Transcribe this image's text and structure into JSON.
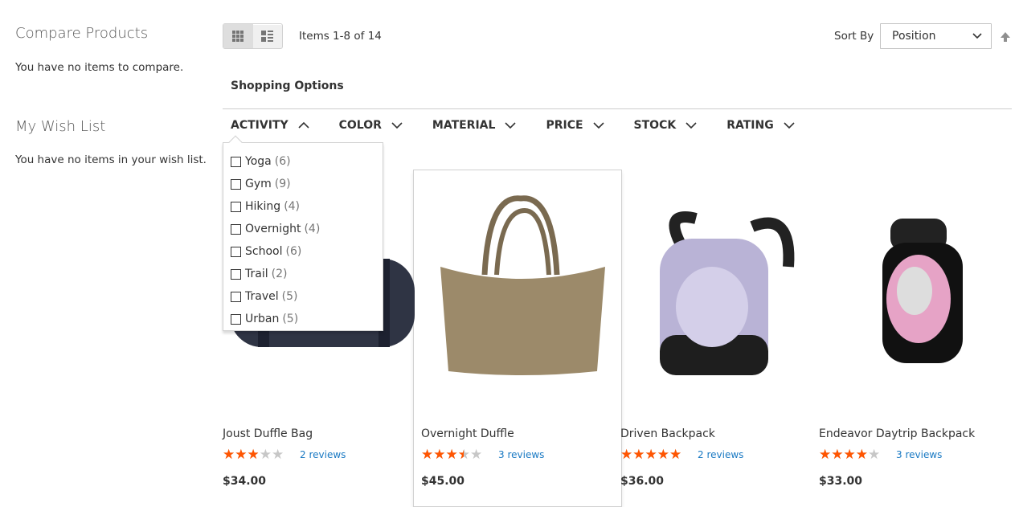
{
  "sidebar": {
    "compare_title": "Compare Products",
    "compare_text": "You have no items to compare.",
    "wishlist_title": "My Wish List",
    "wishlist_text": "You have no items in your wish list."
  },
  "toolbar": {
    "modes": [
      {
        "icon": "grid-icon",
        "active": true
      },
      {
        "icon": "list-icon",
        "active": false
      }
    ],
    "amount": "Items 1-8 of 14",
    "sort_label": "Sort By",
    "sort_value": "Position",
    "sort_direction_icon": "arrow-up-icon"
  },
  "filters": {
    "title": "Shopping Options",
    "items": [
      {
        "label": "ACTIVITY",
        "open": true
      },
      {
        "label": "COLOR"
      },
      {
        "label": "MATERIAL"
      },
      {
        "label": "PRICE"
      },
      {
        "label": "STOCK"
      },
      {
        "label": "RATING"
      }
    ],
    "activity_options": [
      {
        "label": "Yoga",
        "count": "(6)"
      },
      {
        "label": "Gym",
        "count": "(9)"
      },
      {
        "label": "Hiking",
        "count": "(4)"
      },
      {
        "label": "Overnight",
        "count": "(4)"
      },
      {
        "label": "School",
        "count": "(6)"
      },
      {
        "label": "Trail",
        "count": "(2)"
      },
      {
        "label": "Travel",
        "count": "(5)"
      },
      {
        "label": "Urban",
        "count": "(5)"
      }
    ]
  },
  "products": [
    {
      "name": "Joust Duffle Bag",
      "rating_percent": 50,
      "reviews": "2 reviews",
      "price": "$34.00"
    },
    {
      "name": "Overnight Duffle",
      "rating_percent": 60,
      "reviews": "3 reviews",
      "price": "$45.00"
    },
    {
      "name": "Driven Backpack",
      "rating_percent": 90,
      "reviews": "2 reviews",
      "price": "$36.00"
    },
    {
      "name": "Endeavor Daytrip Backpack",
      "rating_percent": 70,
      "reviews": "3 reviews",
      "price": "$33.00"
    }
  ],
  "colors": {
    "star": "#ff5501",
    "link": "#1979c3"
  }
}
